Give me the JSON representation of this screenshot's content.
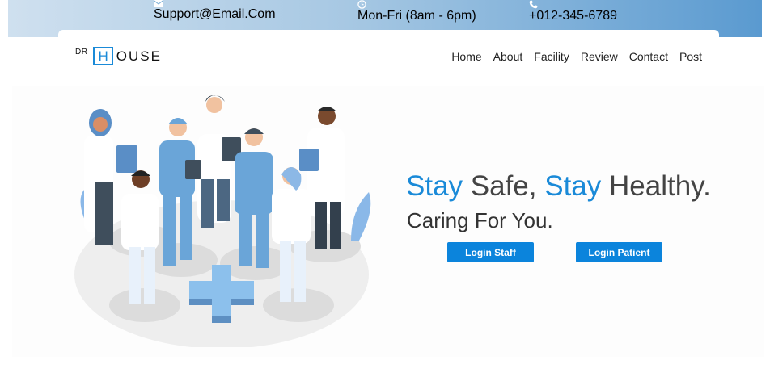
{
  "topbar": {
    "email": "Support@Email.Com",
    "hours": "Mon-Fri (8am - 6pm)",
    "phone": "+012-345-6789"
  },
  "logo": {
    "prefix": "DR",
    "box_letter": "H",
    "rest": "OUSE"
  },
  "nav": {
    "items": [
      "Home",
      "About",
      "Facility",
      "Review",
      "Contact",
      "Post"
    ]
  },
  "hero": {
    "title_part1": "Stay",
    "title_part2": " Safe, ",
    "title_part3": "Stay",
    "title_part4": " Healthy.",
    "subtitle": "Caring For You.",
    "login_staff": "Login Staff",
    "login_patient": "Login Patient"
  },
  "colors": {
    "accent": "#1a8ad8",
    "button": "#0b84dc",
    "topbar_end": "#5a9ad0"
  },
  "icons": {
    "email": "envelope-icon",
    "hours": "clock-icon",
    "phone": "phone-icon"
  }
}
